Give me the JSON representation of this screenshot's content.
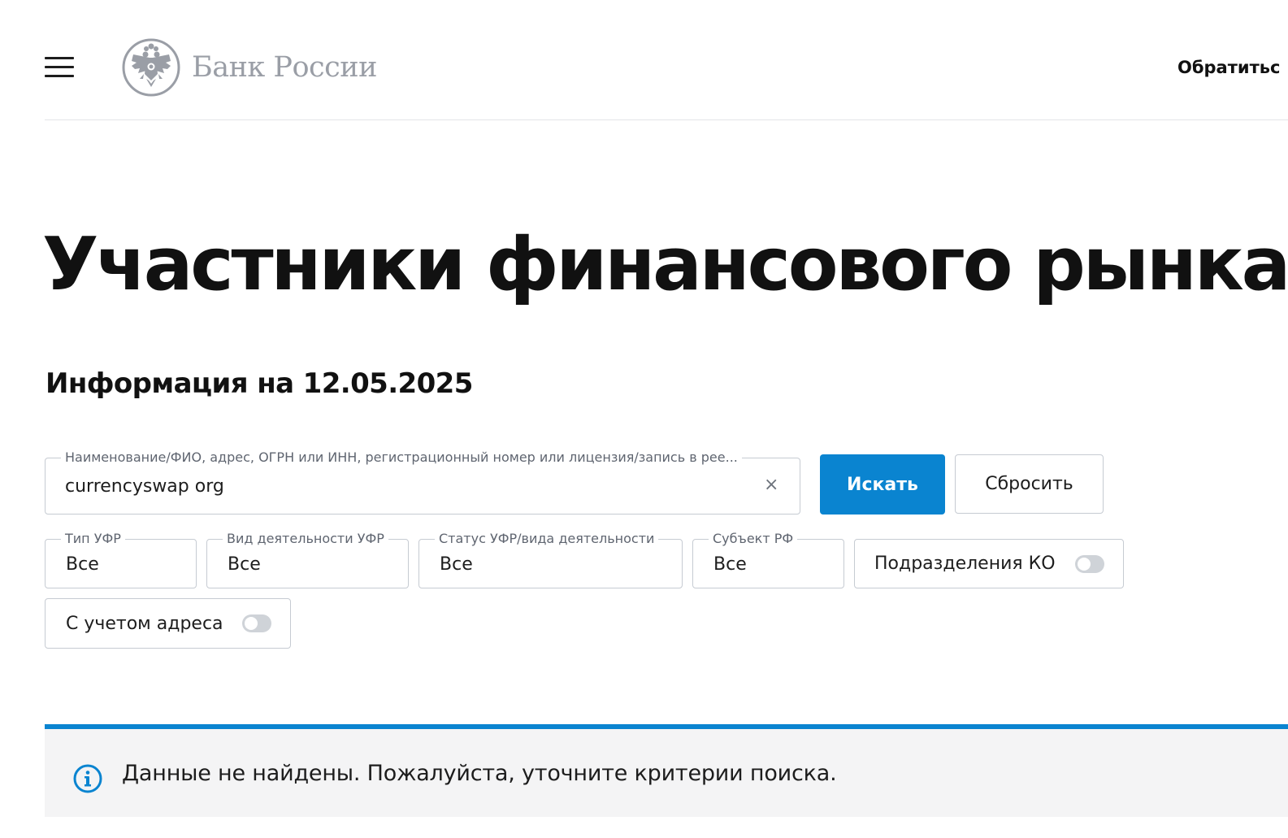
{
  "header": {
    "logo_text": "Банк России",
    "contact_link": "Обратитьс"
  },
  "main": {
    "title": "Участники финансового рынка",
    "info_date": "Информация на 12.05.2025"
  },
  "search": {
    "label": "Наименование/ФИО, адрес, ОГРН или ИНН, регистрационный номер или лицензия/запись в рее...",
    "value": "currencyswap org",
    "clear_glyph": "×",
    "search_button": "Искать",
    "reset_button": "Сбросить"
  },
  "filters": {
    "type": {
      "label": "Тип УФР",
      "value": "Все"
    },
    "kind": {
      "label": "Вид деятельности УФР",
      "value": "Все"
    },
    "status": {
      "label": "Статус УФР/вида деятельности",
      "value": "Все"
    },
    "subject": {
      "label": "Субъект РФ",
      "value": "Все"
    },
    "ko_divisions": {
      "label": "Подразделения КО",
      "enabled": false
    },
    "with_address": {
      "label": "С учетом адреса",
      "enabled": false
    }
  },
  "alert": {
    "message": "Данные не найдены. Пожалуйста, уточните критерии поиска.",
    "icon": "info-icon"
  },
  "colors": {
    "accent": "#0a84d0",
    "logo_gray": "#9a9ea6",
    "border": "#c6cbd2",
    "alert_bg": "#f4f4f5"
  }
}
